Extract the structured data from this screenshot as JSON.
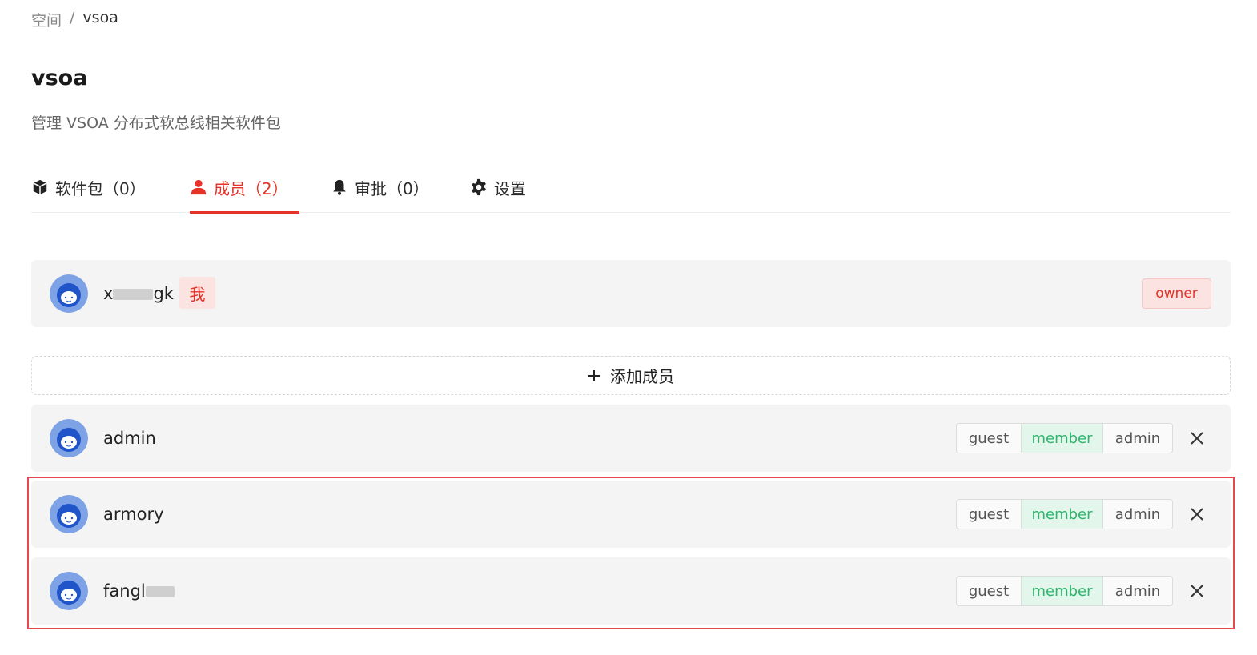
{
  "breadcrumb": {
    "root": "空间",
    "separator": "/",
    "current": "vsoa"
  },
  "page": {
    "title": "vsoa",
    "description": "管理 VSOA 分布式软总线相关软件包"
  },
  "tabs": [
    {
      "label": "软件包（0）",
      "icon": "cube-icon",
      "active": false
    },
    {
      "label": "成员（2）",
      "icon": "user-icon",
      "active": true
    },
    {
      "label": "审批（0）",
      "icon": "bell-icon",
      "active": false
    },
    {
      "label": "设置",
      "icon": "gear-icon",
      "active": false
    }
  ],
  "owner_member": {
    "name_prefix": "x",
    "name_suffix": "gk",
    "me_badge": "我",
    "role_badge": "owner"
  },
  "add_member": {
    "label": "添加成员"
  },
  "members": [
    {
      "name": "admin",
      "roles": [
        "guest",
        "member",
        "admin"
      ],
      "selected": "member"
    },
    {
      "name": "armory",
      "roles": [
        "guest",
        "member",
        "admin"
      ],
      "selected": "member"
    },
    {
      "name": "fangl",
      "roles": [
        "guest",
        "member",
        "admin"
      ],
      "selected": "member"
    }
  ],
  "colors": {
    "accent": "#e5332a",
    "selected_role": "#2cb56b",
    "highlight_box": "#e5484d"
  }
}
